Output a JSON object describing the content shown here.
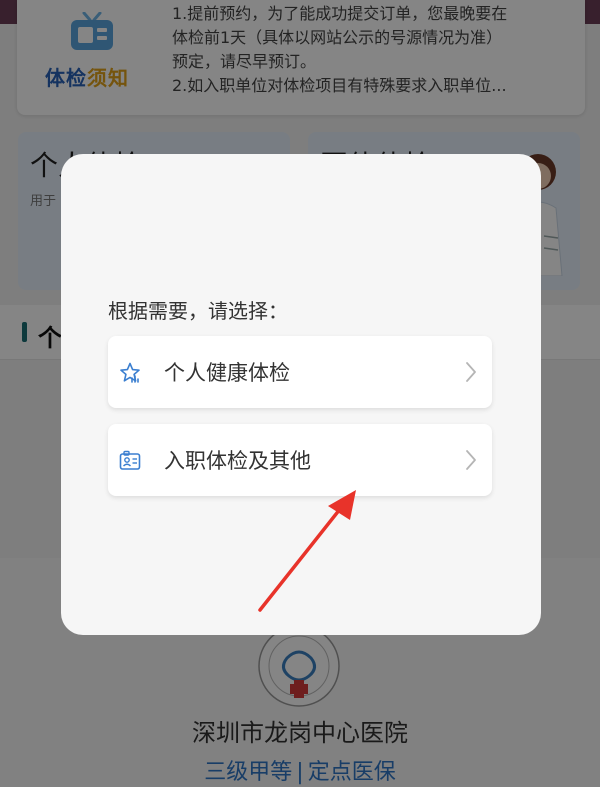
{
  "notice": {
    "brand_part1": "体检",
    "brand_part2": "须知",
    "lines": [
      "1.提前预约，为了能成功提交订单，您最晚要在",
      "体检前1天（具体以网站公示的号源情况为准）",
      "预定，请尽早预订。",
      "2.如入职单位对体检项目有特殊要求入职单位..."
    ]
  },
  "cards": {
    "left": {
      "title": "个人体检",
      "subtitle": "用于"
    },
    "right": {
      "title": "团体体检"
    }
  },
  "section": {
    "title": "个"
  },
  "footer": {
    "hospital_name": "深圳市龙岗中心医院",
    "tag1": "三级甲等",
    "separator": "|",
    "tag2": "定点医保"
  },
  "dialog": {
    "prompt": "根据需要，请选择：",
    "options": [
      {
        "label": "个人健康体检",
        "icon": "star-icon"
      },
      {
        "label": "入职体检及其他",
        "icon": "id-card-icon"
      }
    ]
  },
  "colors": {
    "accent": "#2a62b8",
    "brand_gold": "#e0a21a",
    "link_blue": "#2f76c6",
    "arrow_red": "#e8332a"
  }
}
